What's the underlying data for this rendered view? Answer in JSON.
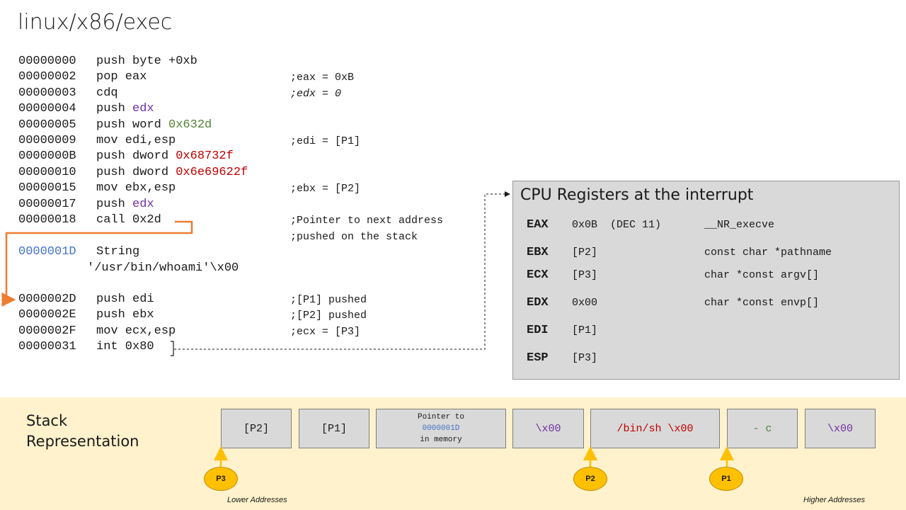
{
  "title": "linux/x86/exec",
  "code_lines": [
    {
      "addr": "00000000",
      "pre": "push byte +0xb",
      "hl": "",
      "hl_color": "",
      "comment": ""
    },
    {
      "addr": "00000002",
      "pre": "pop eax",
      "hl": "",
      "hl_color": "",
      "comment": ";eax = 0xB"
    },
    {
      "addr": "00000003",
      "pre": "cdq",
      "hl": "",
      "hl_color": "",
      "comment": ";edx = 0"
    },
    {
      "addr": "00000004",
      "pre": "push ",
      "hl": "edx",
      "hl_color": "#7030a0",
      "comment": ""
    },
    {
      "addr": "00000005",
      "pre": "push word ",
      "hl": "0x632d",
      "hl_color": "#548235",
      "comment": ""
    },
    {
      "addr": "00000009",
      "pre": "mov edi,esp",
      "hl": "",
      "hl_color": "",
      "comment": ";edi = [P1]"
    },
    {
      "addr": "0000000B",
      "pre": "push dword ",
      "hl": "0x68732f",
      "hl_color": "#c00000",
      "comment": ""
    },
    {
      "addr": "00000010",
      "pre": "push dword ",
      "hl": "0x6e69622f",
      "hl_color": "#c00000",
      "comment": ""
    },
    {
      "addr": "00000015",
      "pre": "mov ebx,esp",
      "hl": "",
      "hl_color": "",
      "comment": ";ebx = [P2]"
    },
    {
      "addr": "00000017",
      "pre": "push ",
      "hl": "edx",
      "hl_color": "#7030a0",
      "comment": ""
    },
    {
      "addr": "00000018",
      "pre": "call 0x2d",
      "hl": "",
      "hl_color": "",
      "comment": ";Pointer to next address"
    }
  ],
  "call_comment_2": ";pushed on the stack",
  "string_block": {
    "addr": "0000001D",
    "label": "String",
    "value": "'/usr/bin/whoami'\\x00"
  },
  "code_lines_2": [
    {
      "addr": "0000002D",
      "instr": "push edi",
      "comment": ";[P1] pushed"
    },
    {
      "addr": "0000002E",
      "instr": "push ebx",
      "comment": ";[P2] pushed"
    },
    {
      "addr": "0000002F",
      "instr": "mov ecx,esp",
      "comment": ";ecx = [P3]"
    },
    {
      "addr": "00000031",
      "instr": "int 0x80",
      "comment": ""
    }
  ],
  "registers": {
    "title": "CPU Registers at the interrupt",
    "rows": [
      {
        "name": "EAX",
        "value": "0x0B  (DEC 11)",
        "desc": "__NR_execve"
      },
      {
        "name": "EBX",
        "value": "[P2]",
        "desc": "const char *pathname"
      },
      {
        "name": "ECX",
        "value": "[P3]",
        "desc": "char *const argv[]"
      },
      {
        "name": "EDX",
        "value": "0x00",
        "desc": "char *const envp[]"
      },
      {
        "name": "EDI",
        "value": "[P1]",
        "desc": ""
      },
      {
        "name": "ESP",
        "value": "[P3]",
        "desc": ""
      }
    ]
  },
  "stack": {
    "title_line1": "Stack",
    "title_line2": "Representation",
    "cells": [
      {
        "text": "[P2]",
        "color": "#1a1a1a"
      },
      {
        "text": "[P1]",
        "color": "#1a1a1a"
      },
      {
        "line1": "Pointer to",
        "line2": "0000001D",
        "line3": "in memory"
      },
      {
        "text": "\\x00",
        "color": "#7030a0"
      },
      {
        "text_a": "/bin/sh ",
        "text_b": "\\x00",
        "color_a": "#c00000",
        "color_b": "#c00000"
      },
      {
        "text": "- c",
        "color": "#548235"
      },
      {
        "text": "\\x00",
        "color": "#7030a0"
      }
    ],
    "pointers": [
      "P3",
      "P2",
      "P1"
    ],
    "lower_label": "Lower Addresses",
    "higher_label": "Higher Addresses"
  },
  "colors": {
    "address_blue": "#4472c4",
    "arrow_orange": "#ed7d31",
    "pointer_yellow": "#ffc000",
    "panel_gray": "#d9d9d9",
    "band_yellow": "#fff2cc"
  }
}
